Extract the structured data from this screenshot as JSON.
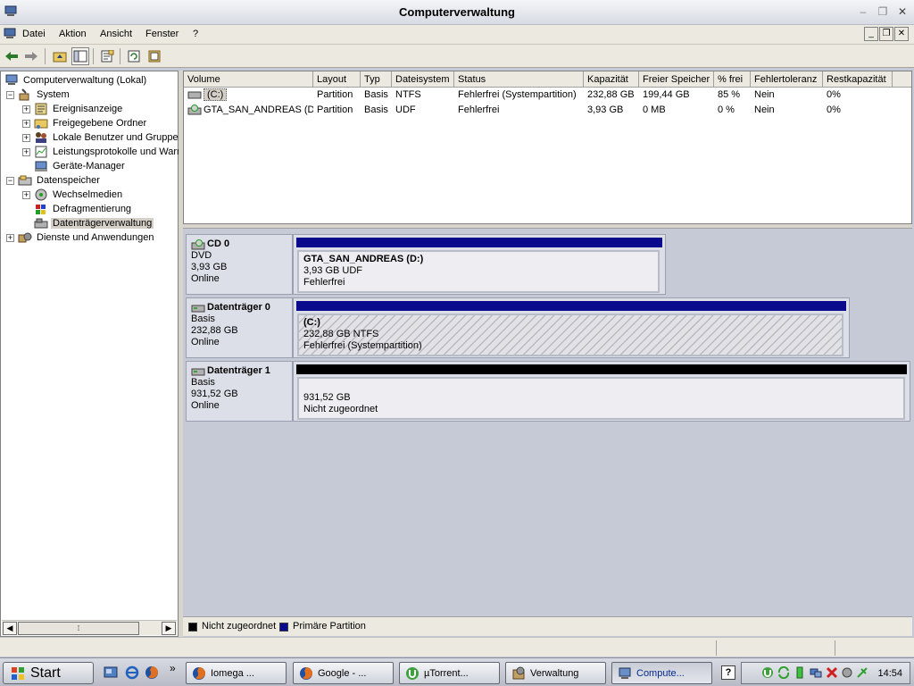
{
  "window": {
    "title": "Computerverwaltung",
    "min": "–",
    "restore": "❐",
    "close": "✕"
  },
  "menu": {
    "items": [
      "Datei",
      "Aktion",
      "Ansicht",
      "Fenster",
      "?"
    ],
    "mdi_min": "_",
    "mdi_restore": "❐",
    "mdi_close": "✕"
  },
  "tree": {
    "items": [
      {
        "label": "Computerverwaltung (Lokal)",
        "exp": "",
        "level": 0,
        "icon": "computer-icon"
      },
      {
        "label": "System",
        "exp": "−",
        "level": 1,
        "icon": "tools-icon"
      },
      {
        "label": "Ereignisanzeige",
        "exp": "+",
        "level": 2,
        "icon": "event-viewer-icon"
      },
      {
        "label": "Freigegebene Ordner",
        "exp": "+",
        "level": 2,
        "icon": "shared-folder-icon"
      },
      {
        "label": "Lokale Benutzer und Gruppen",
        "exp": "+",
        "level": 2,
        "icon": "users-icon"
      },
      {
        "label": "Leistungsprotokolle und Warnungen",
        "exp": "+",
        "level": 2,
        "icon": "performance-icon"
      },
      {
        "label": "Geräte-Manager",
        "exp": "",
        "level": 2,
        "icon": "device-manager-icon"
      },
      {
        "label": "Datenspeicher",
        "exp": "−",
        "level": 1,
        "icon": "storage-icon"
      },
      {
        "label": "Wechselmedien",
        "exp": "+",
        "level": 2,
        "icon": "removable-media-icon"
      },
      {
        "label": "Defragmentierung",
        "exp": "",
        "level": 2,
        "icon": "defrag-icon"
      },
      {
        "label": "Datenträgerverwaltung",
        "exp": "",
        "level": 2,
        "icon": "disk-management-icon",
        "selected": true
      },
      {
        "label": "Dienste und Anwendungen",
        "exp": "+",
        "level": 1,
        "icon": "services-icon"
      }
    ],
    "scroll_thumb_glyph": "⁞"
  },
  "volumes": {
    "columns": [
      "Volume",
      "Layout",
      "Typ",
      "Dateisystem",
      "Status",
      "Kapazität",
      "Freier Speicher",
      "% frei",
      "Fehlertoleranz",
      "Restkapazität"
    ],
    "rows": [
      [
        "(C:)",
        "Partition",
        "Basis",
        "NTFS",
        "Fehlerfrei (Systempartition)",
        "232,88 GB",
        "199,44 GB",
        "85 %",
        "Nein",
        "0%"
      ],
      [
        "GTA_SAN_ANDREAS (D:)",
        "Partition",
        "Basis",
        "UDF",
        "Fehlerfrei",
        "3,93 GB",
        "0 MB",
        "0 %",
        "Nein",
        "0%"
      ]
    ]
  },
  "disks": [
    {
      "name": "CD 0",
      "type": "DVD",
      "size": "3,93 GB",
      "state": "Online",
      "partition": {
        "name": "GTA_SAN_ANDREAS  (D:)",
        "detail": "3,93 GB UDF",
        "status": "Fehlerfrei"
      }
    },
    {
      "name": "Datenträger 0",
      "type": "Basis",
      "size": "232,88 GB",
      "state": "Online",
      "partition": {
        "name": " (C:)",
        "detail": "232,88 GB NTFS",
        "status": "Fehlerfrei (Systempartition)"
      }
    },
    {
      "name": "Datenträger 1",
      "type": "Basis",
      "size": "931,52 GB",
      "state": "Online",
      "partition": {
        "name": "",
        "detail": "931,52 GB",
        "status": "Nicht zugeordnet"
      }
    }
  ],
  "legend": [
    {
      "label": "Nicht zugeordnet",
      "color": "#000000"
    },
    {
      "label": "Primäre Partition",
      "color": "#0a0a8c"
    }
  ],
  "colors": {
    "primary_bar": "#0a0a8c",
    "unallocated_bar": "#000000"
  },
  "taskbar": {
    "start": "Start",
    "more": "»",
    "tasks": [
      {
        "label": "Iomega ...",
        "icon": "firefox-icon"
      },
      {
        "label": "Google - ...",
        "icon": "firefox-icon"
      },
      {
        "label": "µTorrent...",
        "icon": "utorrent-icon"
      },
      {
        "label": "Verwaltung",
        "icon": "admin-tools-icon"
      },
      {
        "label": "Compute...",
        "icon": "computer-icon",
        "active": true
      }
    ],
    "help": "?",
    "clock": "14:54"
  }
}
